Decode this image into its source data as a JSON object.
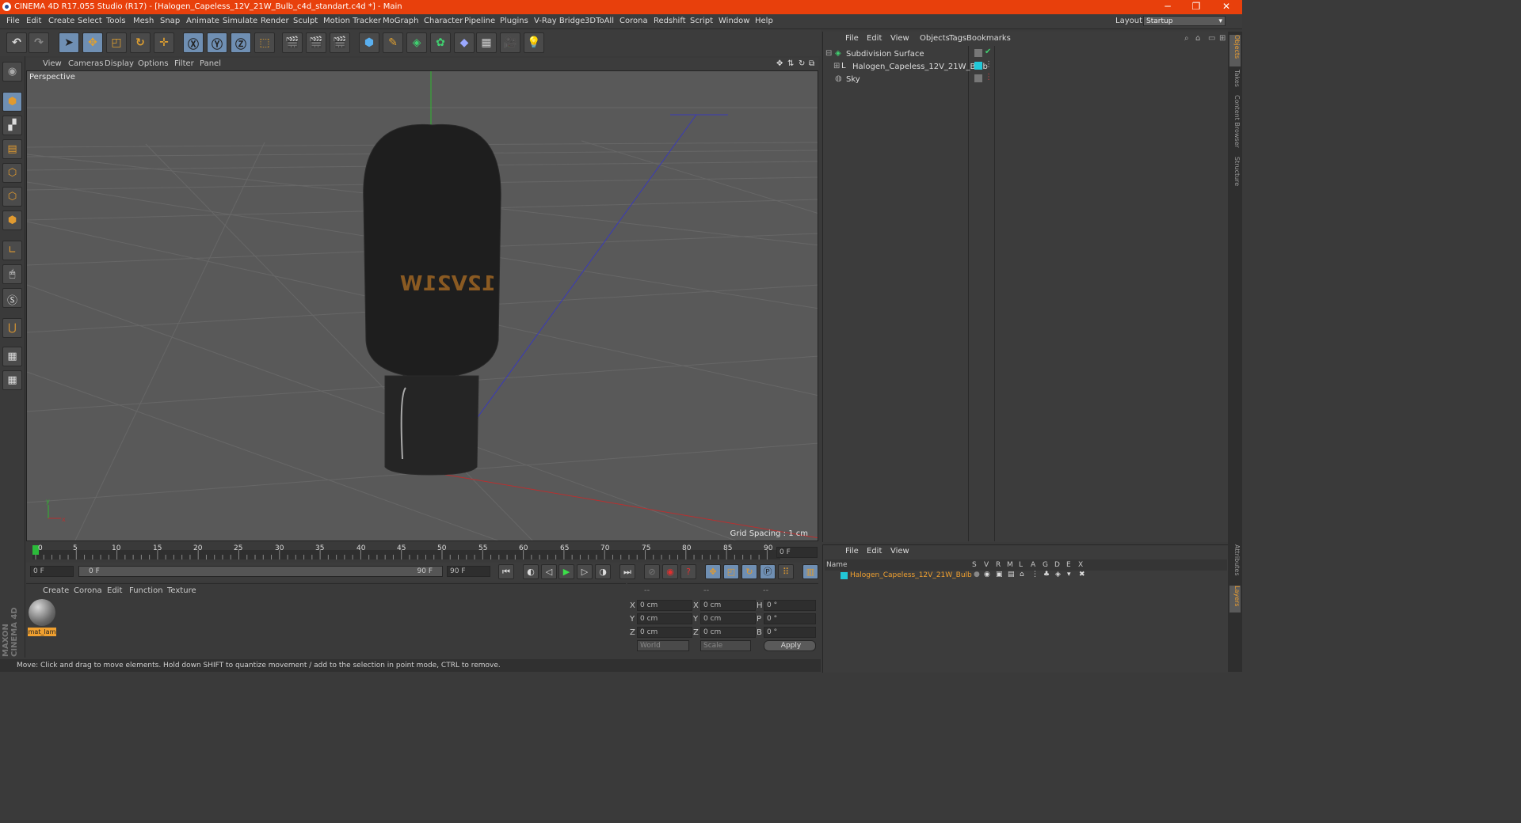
{
  "window": {
    "title": "CINEMA 4D R17.055 Studio (R17) - [Halogen_Capeless_12V_21W_Bulb_c4d_standart.c4d *] - Main",
    "minimize": "─",
    "restore": "❐",
    "close": "✕"
  },
  "menu": [
    "File",
    "Edit",
    "Create",
    "Select",
    "Tools",
    "Mesh",
    "Snap",
    "Animate",
    "Simulate",
    "Render",
    "Sculpt",
    "Motion Tracker",
    "MoGraph",
    "Character",
    "Pipeline",
    "Plugins",
    "V-Ray Bridge",
    "3DToAll",
    "Corona",
    "Redshift",
    "Script",
    "Window",
    "Help"
  ],
  "layout": {
    "label": "Layout:",
    "value": "Startup"
  },
  "viewport": {
    "menu": [
      "View",
      "Cameras",
      "Display",
      "Options",
      "Filter",
      "Panel"
    ],
    "label": "Perspective",
    "grid_spacing": "Grid Spacing : 1 cm",
    "bulb_text": "12V21W"
  },
  "timeline": {
    "ticks": [
      "0",
      "5",
      "10",
      "15",
      "20",
      "25",
      "30",
      "35",
      "40",
      "45",
      "50",
      "55",
      "60",
      "65",
      "70",
      "75",
      "80",
      "85",
      "90"
    ],
    "current_frame": "0 F",
    "start": "0 F",
    "range_start": "0 F",
    "range_end": "90 F",
    "end": "90 F"
  },
  "material_panel": {
    "menu": [
      "Create",
      "Corona",
      "Edit",
      "Function",
      "Texture"
    ],
    "material_name": "mat_lam"
  },
  "coords": {
    "headers": [
      "--",
      "--",
      "--"
    ],
    "rows": [
      {
        "a": "X",
        "av": "0 cm",
        "b": "X",
        "bv": "0 cm",
        "c": "H",
        "cv": "0 °"
      },
      {
        "a": "Y",
        "av": "0 cm",
        "b": "Y",
        "bv": "0 cm",
        "c": "P",
        "cv": "0 °"
      },
      {
        "a": "Z",
        "av": "0 cm",
        "b": "Z",
        "bv": "0 cm",
        "c": "B",
        "cv": "0 °"
      }
    ],
    "world": "World",
    "scale": "Scale",
    "apply": "Apply"
  },
  "status": "Move: Click and drag to move elements. Hold down SHIFT to quantize movement / add to the selection in point mode, CTRL to remove.",
  "objects": {
    "menu": [
      "File",
      "Edit",
      "View",
      "Objects",
      "Tags",
      "Bookmarks"
    ],
    "items": [
      {
        "name": "Subdivision Surface"
      },
      {
        "name": "Halogen_Capeless_12V_21W_Bulb"
      },
      {
        "name": "Sky"
      }
    ]
  },
  "layers": {
    "menu": [
      "File",
      "Edit",
      "View"
    ],
    "columns": [
      "Name",
      "S",
      "V",
      "R",
      "M",
      "L",
      "A",
      "G",
      "D",
      "E",
      "X"
    ],
    "row": "Halogen_Capeless_12V_21W_Bulb"
  },
  "side_tabs": [
    "Objects",
    "Takes",
    "Content Browser",
    "Structure",
    "Attributes",
    "Layers"
  ],
  "brand": "MAXON CINEMA 4D",
  "colors": {
    "accent": "#e8400c",
    "selection": "#f0a030",
    "layer_cyan": "#22c8d8"
  }
}
